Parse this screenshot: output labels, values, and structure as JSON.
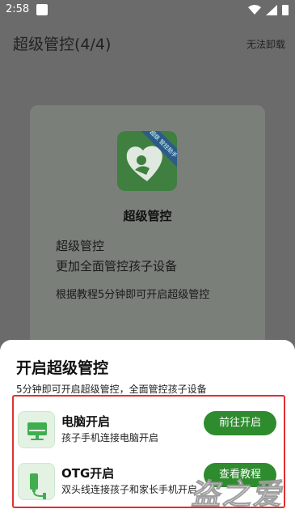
{
  "status_bar": {
    "time": "2:58"
  },
  "app_bar": {
    "title": "超级管控(4/4)",
    "action": "无法卸载"
  },
  "card": {
    "logo_ribbon": "超级 管控助手",
    "app_name": "超级管控",
    "line1": "超级管控",
    "line2": "更加全面管控孩子设备",
    "line3": "根据教程5分钟即可开启超级管控"
  },
  "sheet": {
    "title": "开启超级管控",
    "subtitle": "5分钟即可开启超级管控，全面管控孩子设备",
    "options": [
      {
        "title": "电脑开启",
        "desc": "孩子手机连接电脑开启",
        "button": "前往开启",
        "icon": "computer-icon"
      },
      {
        "title": "OTG开启",
        "desc": "双头线连接孩子和家长手机开启",
        "button": "查看教程",
        "icon": "otg-cable-icon"
      }
    ]
  },
  "watermark": "盗之爱",
  "colors": {
    "accent": "#2e8b2e",
    "highlight_border": "#e03030",
    "scrim": "#6b6b6b"
  }
}
